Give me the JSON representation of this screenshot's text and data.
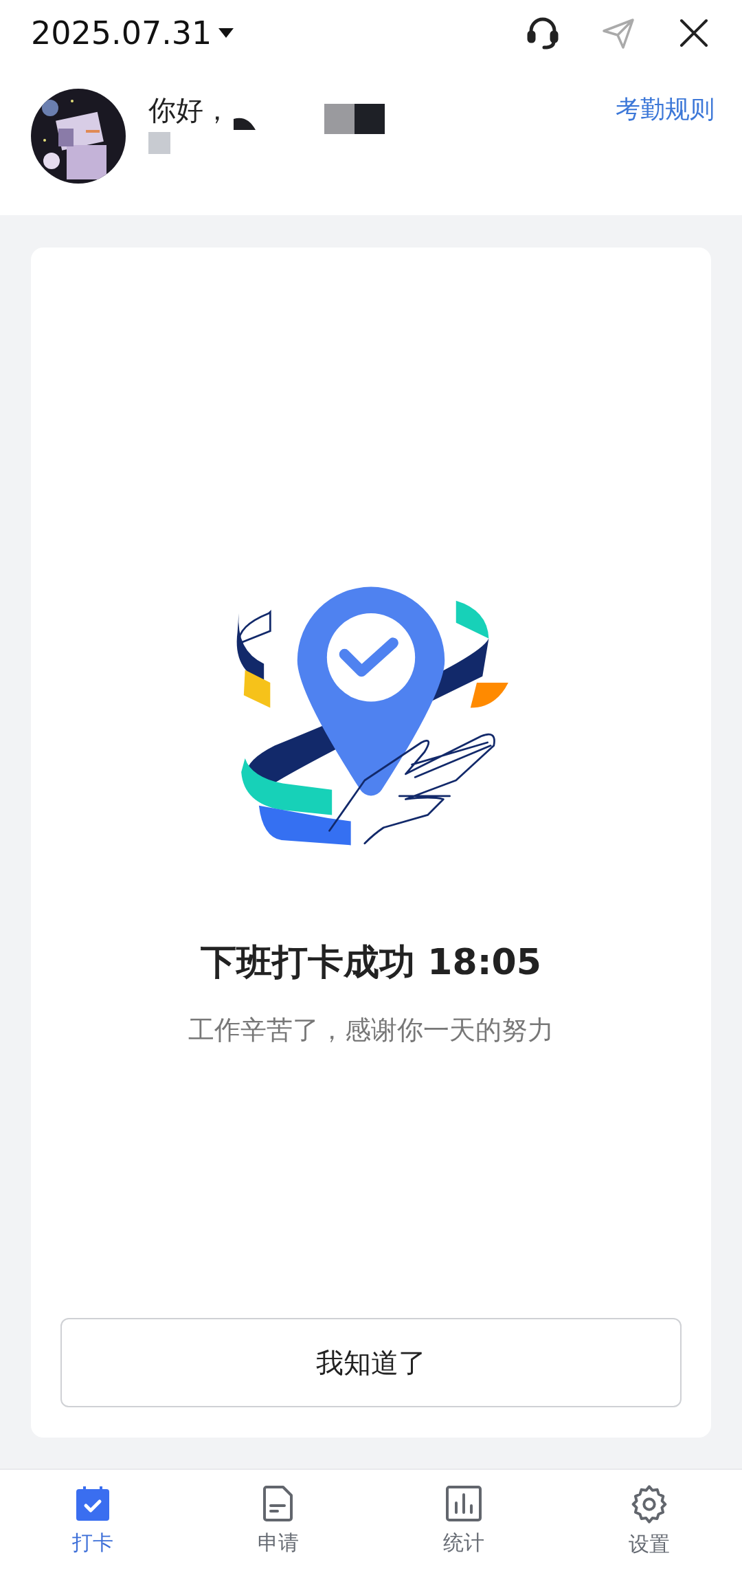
{
  "header": {
    "date": "2025.07.31",
    "greeting": "你好，",
    "rules_link": "考勤规则"
  },
  "result": {
    "title": "下班打卡成功 18:05",
    "subtitle": "工作辛苦了，感谢你一天的努力",
    "button": "我知道了"
  },
  "tabs": [
    {
      "label": "打卡",
      "selected": true,
      "kind": "calendar"
    },
    {
      "label": "申请",
      "selected": false,
      "kind": "document"
    },
    {
      "label": "统计",
      "selected": false,
      "kind": "chart"
    },
    {
      "label": "设置",
      "selected": false,
      "kind": "gear"
    }
  ]
}
